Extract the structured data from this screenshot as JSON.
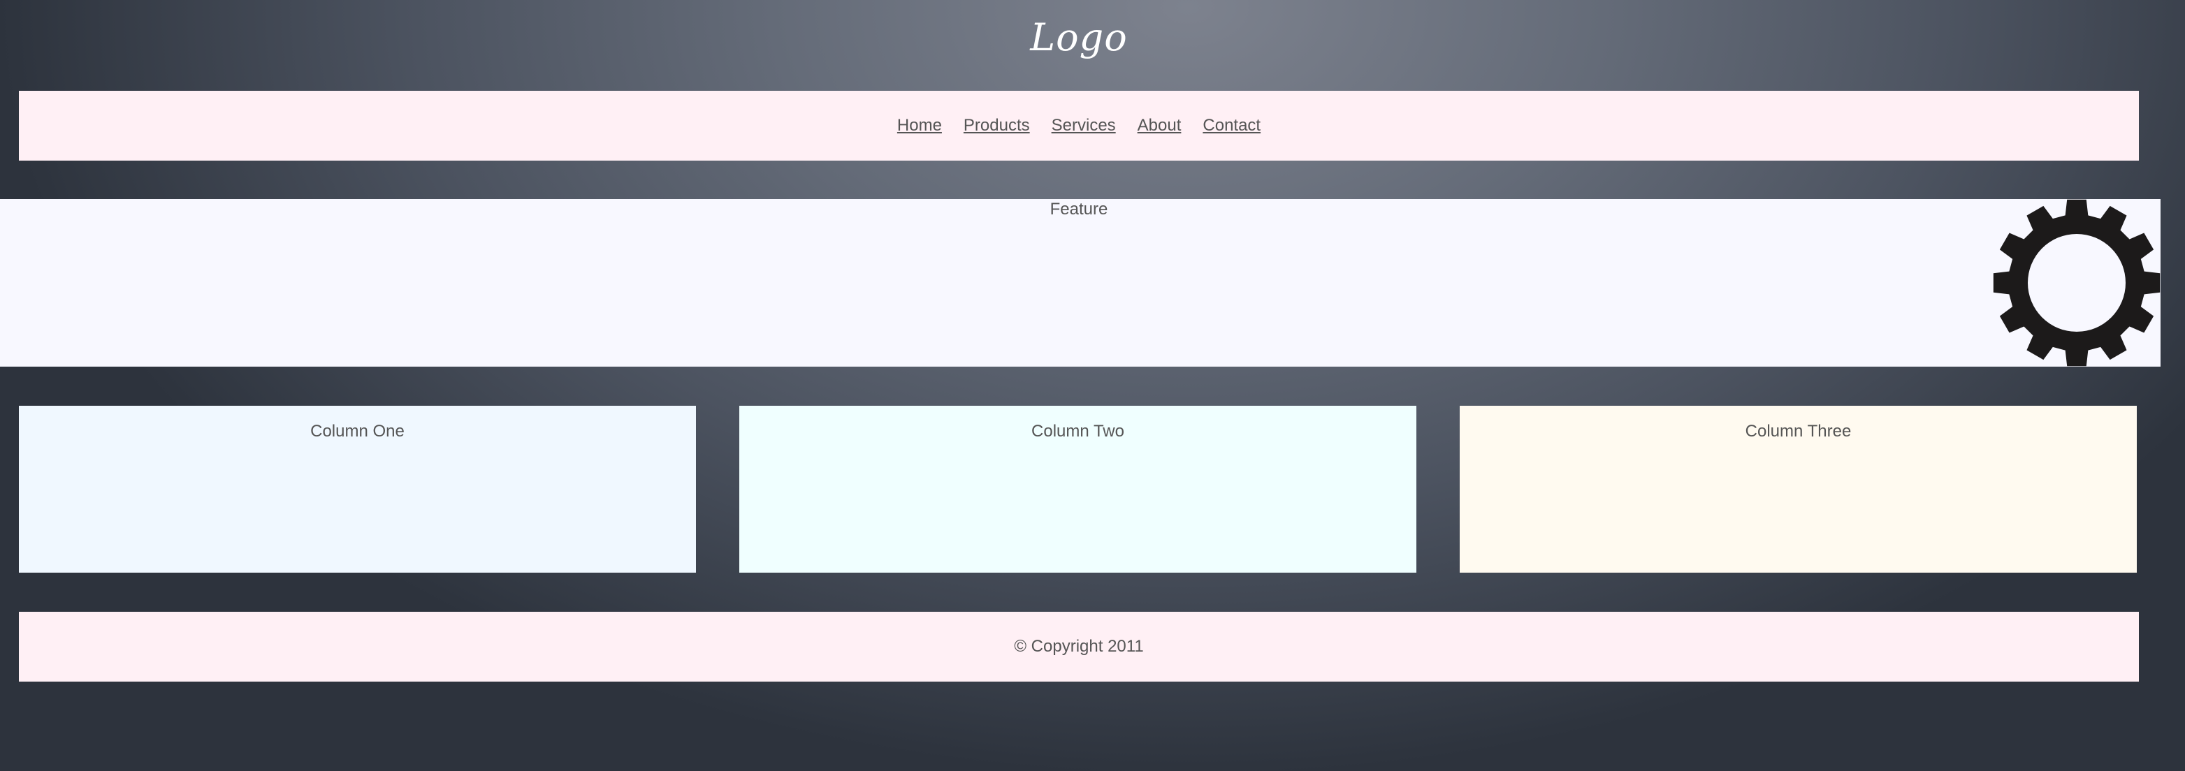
{
  "header": {
    "logo": "Logo"
  },
  "nav": {
    "items": [
      {
        "label": "Home"
      },
      {
        "label": "Products"
      },
      {
        "label": "Services"
      },
      {
        "label": "About"
      },
      {
        "label": "Contact"
      }
    ]
  },
  "feature": {
    "label": "Feature",
    "icon": "gear-icon"
  },
  "columns": [
    {
      "label": "Column One"
    },
    {
      "label": "Column Two"
    },
    {
      "label": "Column Three"
    }
  ],
  "footer": {
    "copyright": "© Copyright 2011"
  },
  "colors": {
    "nav_bg": "#fff0f5",
    "feature_bg": "#f8f8ff",
    "column_one_bg": "#f0f8ff",
    "column_two_bg": "#f0ffff",
    "column_three_bg": "#fffaf0",
    "text": "#555555",
    "gear": "#1c1a1a"
  }
}
